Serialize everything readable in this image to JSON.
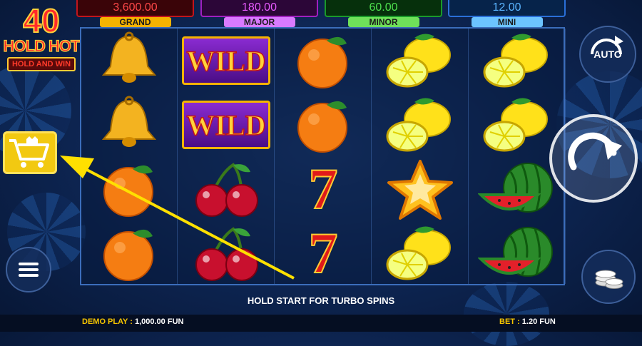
{
  "logo": {
    "number": "40",
    "line1": "HOLD HOT",
    "line2": "HOLD AND WIN"
  },
  "jackpots": [
    {
      "name": "GRAND",
      "value": "3,600.00",
      "color": "#ff4848",
      "border": "#c2151c",
      "bg": "#3a0408",
      "tag_bg": "#f5b300"
    },
    {
      "name": "MAJOR",
      "value": "180.00",
      "color": "#e85bff",
      "border": "#a020c0",
      "bg": "#2c0638",
      "tag_bg": "#d97aff"
    },
    {
      "name": "MINOR",
      "value": "60.00",
      "color": "#4ee24e",
      "border": "#1a9a2a",
      "bg": "#06300c",
      "tag_bg": "#6fe05a"
    },
    {
      "name": "MINI",
      "value": "12.00",
      "color": "#5ab4ff",
      "border": "#2a6fd8",
      "bg": "#06234a",
      "tag_bg": "#6cc4ff"
    }
  ],
  "reels": [
    [
      "bell",
      "bell",
      "orange",
      "orange"
    ],
    [
      "wild",
      "wild",
      "cherries",
      "cherries"
    ],
    [
      "orange",
      "orange",
      "seven",
      "seven"
    ],
    [
      "lemon",
      "lemon",
      "star",
      "lemon"
    ],
    [
      "lemon",
      "lemon",
      "watermelon",
      "watermelon"
    ]
  ],
  "wild_label": "WILD",
  "seven_label": "7",
  "buttons": {
    "auto_label": "AUTO"
  },
  "hint": "HOLD START FOR TURBO SPINS",
  "footer": {
    "demo_label": "DEMO PLAY :",
    "demo_value": "1,000.00 FUN",
    "bet_label": "BET :",
    "bet_value": "1.20 FUN"
  },
  "colors": {
    "accent": "#f5c400",
    "arrow": "#ffe000"
  }
}
